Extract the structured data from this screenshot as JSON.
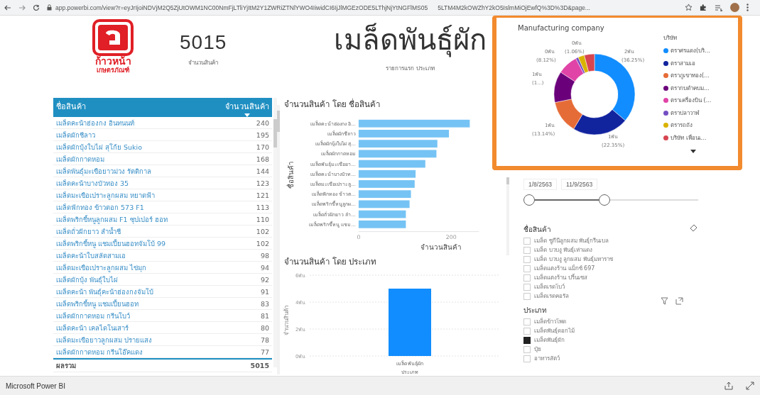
{
  "browser": {
    "url_start": "app.powerbi.com/view?r=eyJrIjoiNDVjM2Q5ZjUtOWM1NC00NmFjLTliYjItM2Y1ZWRiZTNlYWO4IiwidCI6IjJlMGEzODE5LThjNjYtNGFlMS05",
    "url_end": "5LTM4M2kOWZhY2kO5IslmMiOjEwfQ%3D%3D&page..."
  },
  "logo": {
    "line1": "ก้าวหน้า",
    "line2": "เกษตรภัณฑ์"
  },
  "card": {
    "value": "5015",
    "label": "จำนวนสินค้า"
  },
  "heading": {
    "title": "เมล็ดพันธุ์ผัก",
    "subtitle": "รายการแรก ประเภท"
  },
  "table": {
    "columns": [
      {
        "label": "ชื่อสินค้า",
        "sorted": false
      },
      {
        "label": "จำนวนสินค้า",
        "sorted": true
      }
    ],
    "rows": [
      [
        "เมล็ดคะน้าฮ่องกง อินทนนท์",
        "240"
      ],
      [
        "เมล็ดผักชีลาว",
        "195"
      ],
      [
        "เมล็ดผักบุ้งใบไผ่ สุโก้ย Sukio",
        "170"
      ],
      [
        "เมล็ดผักกาดหอม",
        "168"
      ],
      [
        "เมล็ดพันธุ์มะเขือยาวม่วง รัตติกาล",
        "144"
      ],
      [
        "เมล็ดคะน้าบางบัวทอง 35",
        "123"
      ],
      [
        "เมล็ดมะเขือเปราะลูกผสม หยาดฟ้า",
        "121"
      ],
      [
        "เมล็ดฟักทอง ข้าวตอก 573 F1",
        "113"
      ],
      [
        "เมล็ดพริกขี้หนูลูกผสม F1 ซุปเปอร์ ฮอท",
        "110"
      ],
      [
        "เมล็ดถั่วฝักยาว ลำน้ำชี",
        "102"
      ],
      [
        "เมล็ดพริกขี้หนู แชมเปี้ยนฮอทจัมโบ้ 99",
        "102"
      ],
      [
        "เมล็ดคะน้าใบสลัดสามเอ",
        "98"
      ],
      [
        "เมล็ดมะเขือเปราะลูกผสม ไข่มุก",
        "94"
      ],
      [
        "เมล็ดผักบุ้ง พันธุ์ใบไผ่",
        "92"
      ],
      [
        "เมล็ดคะน้า พันธุ์คะน้าฮ่องกงจัมโบ้",
        "91"
      ],
      [
        "เมล็ดพริกขี้หนู แชมเปี้ยนฮอท",
        "83"
      ],
      [
        "เมล็ดผักกาดหอม กรีนโบว์",
        "81"
      ],
      [
        "เมล็ดคะน้า เคลไดโนเสาร์",
        "80"
      ],
      [
        "เมล็ดมะเขือยาวลูกผสม ปรายแสง",
        "78"
      ],
      [
        "เมล็ดผักกาดหอม กรีนโอ๊คแดง",
        "77"
      ]
    ],
    "total": [
      "ผลรวม",
      "5015"
    ]
  },
  "bar_chart": {
    "chart_data": {
      "type": "bar",
      "orientation": "horizontal",
      "title": "จำนวนสินค้า โดย ชื่อสินค้า",
      "xlabel": "จำนวนสินค้า",
      "ylabel": "ชื่อสินค้า",
      "categories": [
        "เมล็ดคะน้าฮ่องกง อิ...",
        "เมล็ดผักชีลาว",
        "เมล็ดผักบุ้งใบไผ่ สุ...",
        "เมล็ดผักกาดหอม",
        "เมล็ดพันธุ์มะเขือยา...",
        "เมล็ดคะน้าบางบัวท...",
        "เมล็ดมะเขือเปราะลู...",
        "เมล็ดฟักทอง ข้าวต...",
        "เมล็ดพริกขี้หนูลูกผ...",
        "เมล็ดถั่วฝักยาว ลำ...",
        "เมล็ดพริกขี้หนู แชม..."
      ],
      "series": [
        {
          "color": "#75c3f4",
          "values": [
            240,
            195,
            170,
            168,
            144,
            123,
            121,
            113,
            110,
            102,
            102
          ]
        }
      ],
      "xlim": [
        0,
        260
      ],
      "xticks": [
        0,
        200
      ]
    }
  },
  "column_chart": {
    "chart_data": {
      "type": "bar",
      "orientation": "vertical",
      "title": "จำนวนสินค้า โดย ประเภท",
      "xlabel": "ประเภท",
      "ylabel": "จำนวนสินค้า",
      "categories": [
        "เมล็ดพันธุ์ผัก"
      ],
      "series": [
        {
          "color": "#118dff",
          "values": [
            5
          ]
        }
      ],
      "ylim": [
        0,
        6
      ],
      "yticks": [
        {
          "value": 0,
          "label": "0พัน"
        },
        {
          "value": 2,
          "label": "2พัน"
        },
        {
          "value": 4,
          "label": "4พัน"
        },
        {
          "value": 6,
          "label": "6พัน"
        }
      ]
    }
  },
  "donut": {
    "legend_title": "บริษัท",
    "chart_data": {
      "type": "donut",
      "title": "Manufacturing company",
      "categories": [
        "ตราศรแดง(บริ...",
        "ตราสามเอ",
        "ตราภูเขาทอง(...",
        "ตรากบดำคบม...",
        "ตราเครื่องบิน (...",
        "ตราปลาวาฬ",
        "ตรารถถัง",
        "บริษัท เพื่อนเ..."
      ],
      "values": [
        36.25,
        22.35,
        13.14,
        12.5,
        8.12,
        1.06,
        2.5,
        4.08
      ],
      "colors": [
        "#118dff",
        "#12239e",
        "#e66c37",
        "#6b007b",
        "#e044a7",
        "#744ec2",
        "#d9b300",
        "#d64550"
      ]
    },
    "slice_labels": [
      {
        "amount": "0พัน",
        "share": "(1.06%)"
      },
      {
        "amount": "0พัน",
        "share": "(8.12%)"
      },
      {
        "amount": "2พัน",
        "share": "(36.25%)"
      },
      {
        "amount": "1พัน",
        "share": "(1...)"
      },
      {
        "amount": "1พัน",
        "share": "(13.14%)"
      },
      {
        "amount": "1พัน",
        "share": "(22.35%)"
      }
    ]
  },
  "date_slicer": {
    "start": "1/8/2563",
    "end": "11/9/2563",
    "level": 0.46
  },
  "name_slicer": {
    "title": "ชื่อสินค้า",
    "items": [
      {
        "label": "เมล็ด ซูกีนีลูกผสม พันธุ์กรีนเบล",
        "checked": false
      },
      {
        "label": "เมล็ด บวบงู พันธุ์เห่าแดง",
        "checked": false
      },
      {
        "label": "เมล็ด บวบงู ลูกผสม พันธุ์มหาราช",
        "checked": false
      },
      {
        "label": "เมล็ดแตงร้าน แม็กซ์ 697",
        "checked": false
      },
      {
        "label": "เมล็ดแตงร้าน ปริ้นเซส",
        "checked": false
      },
      {
        "label": "เมล็ดเรดโบว์",
        "checked": false
      },
      {
        "label": "เมล็ดเรดคอรัล",
        "checked": false
      }
    ]
  },
  "type_slicer": {
    "title": "ประเภท",
    "items": [
      {
        "label": "เมล็ดข้าวโพด",
        "checked": false
      },
      {
        "label": "เมล็ดพันธุ์ดอกไม้",
        "checked": false
      },
      {
        "label": "เมล็ดพันธุ์ผัก",
        "checked": true
      },
      {
        "label": "ปุ๋ย",
        "checked": false
      },
      {
        "label": "อาหารสัตว์",
        "checked": false
      }
    ]
  },
  "status_bar": {
    "text": "Microsoft Power BI"
  }
}
